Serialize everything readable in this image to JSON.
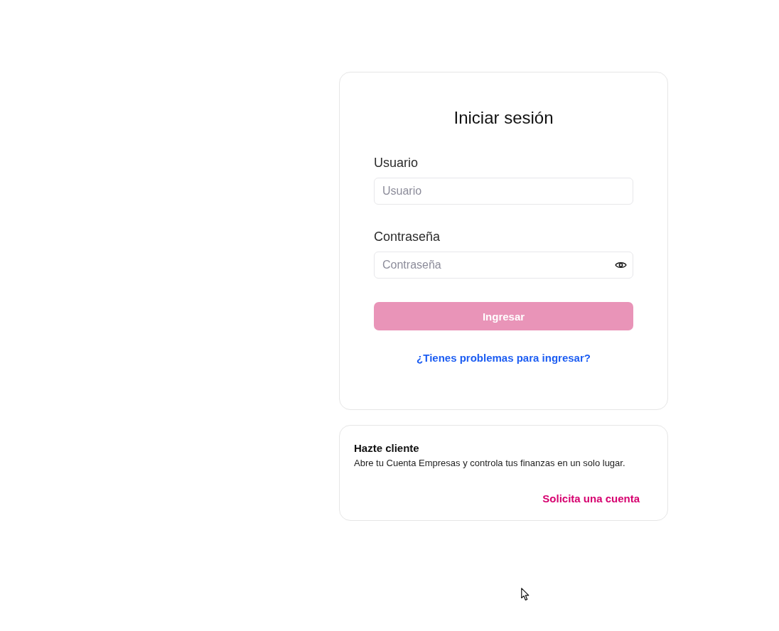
{
  "login": {
    "title": "Iniciar sesión",
    "fields": [
      {
        "kind": "text",
        "label": "Usuario",
        "placeholder": "Usuario"
      },
      {
        "kind": "password",
        "label": "Contraseña",
        "placeholder": "Contraseña"
      }
    ],
    "submit": {
      "label": "Ingresar",
      "disabled": true
    },
    "help_link": "¿Tienes problemas para ingresar?"
  },
  "signup": {
    "title": "Hazte cliente",
    "description": "Abre tu Cuenta Empresas y controla tus finanzas en un solo lugar.",
    "link": "Solicita una cuenta"
  }
}
